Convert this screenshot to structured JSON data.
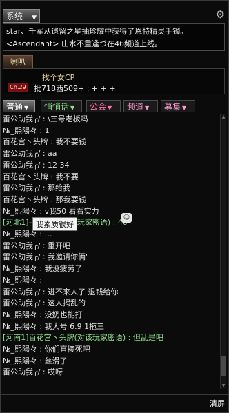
{
  "system": {
    "tab_label": "系统",
    "lines": [
      "star、千军从遗留之星抽珍耀中获得了恩特精灵手镯。",
      "<Ascendant> 山水不重逢づ在46频道上线。"
    ]
  },
  "horn": {
    "tab_label": "喇叭",
    "line1": "找个女CP",
    "badge": "Ch.29",
    "line2": "批718西509+ : + + +"
  },
  "tabs": [
    {
      "label": "普通"
    },
    {
      "label": "悄悄话"
    },
    {
      "label": "公会"
    },
    {
      "label": "频道"
    },
    {
      "label": "募集"
    }
  ],
  "chat": [
    {
      "text": "雷公助我╭/ : \\三号老板吗"
    },
    {
      "text": "№_熙陽々 : 1"
    },
    {
      "text": "百花宫丶头牌 : 我不要钱"
    },
    {
      "text": "雷公助我╭/ : aa"
    },
    {
      "text": "雷公助我╭/ : 12 34"
    },
    {
      "text": "百花宫丶头牌 : 我不要"
    },
    {
      "text": "雷公助我╭/ : 那给我"
    },
    {
      "text": "百花宫丶头牌 : 那我要钱"
    },
    {
      "text": "№_熙陽々 : v我50  看看实力"
    },
    {
      "text": "[河北1]—天天啊(对该玩家密语) : 40",
      "team": true
    },
    {
      "text": "№_熙陽々 : …"
    },
    {
      "text": "雷公助我╭/ : 重开吧"
    },
    {
      "text": "雷公助我╭/ : 我邀请你俩'"
    },
    {
      "text": "№_熙陽々 : 我没疲劳了"
    },
    {
      "text": "№_熙陽々 : ＝＝"
    },
    {
      "text": "雷公助我╭/ : 进不来人了 退钱给你"
    },
    {
      "text": "雷公助我╭/ : 这人揭乱的"
    },
    {
      "text": "№_熙陽々 : 没奶也能打"
    },
    {
      "text": "№_熙陽々 : 我大号   6.9   1拖三"
    },
    {
      "text": "[河南1]百花宫丶头牌(对该玩家密语) : 但乱是吧",
      "team": true
    },
    {
      "text": "№_熙陽々 : 你们直接死吧"
    },
    {
      "text": "№_熙陽々 : 丝滑了"
    },
    {
      "text": "雷公助我╭/ : 哎呀"
    }
  ],
  "tooltip": "我素质很好",
  "clear_label": "清屏"
}
